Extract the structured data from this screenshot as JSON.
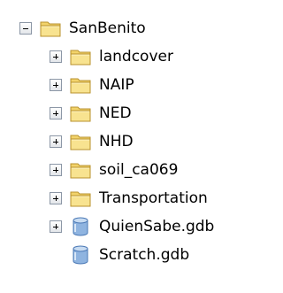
{
  "tree": {
    "root": {
      "label": "SanBenito",
      "expanded": true,
      "icon": "folder-icon"
    },
    "children": [
      {
        "label": "landcover",
        "icon": "folder-icon",
        "expandable": true
      },
      {
        "label": "NAIP",
        "icon": "folder-icon",
        "expandable": true
      },
      {
        "label": "NED",
        "icon": "folder-icon",
        "expandable": true
      },
      {
        "label": "NHD",
        "icon": "folder-icon",
        "expandable": true
      },
      {
        "label": "soil_ca069",
        "icon": "folder-icon",
        "expandable": true
      },
      {
        "label": "Transportation",
        "icon": "folder-icon",
        "expandable": true
      },
      {
        "label": "QuienSabe.gdb",
        "icon": "geodatabase-icon",
        "expandable": true
      },
      {
        "label": "Scratch.gdb",
        "icon": "geodatabase-icon",
        "expandable": false
      }
    ]
  },
  "colors": {
    "folder_fill": "#f7e08a",
    "folder_edge": "#c9a53a",
    "database_fill": "#8fb4e0",
    "database_edge": "#4a78b5",
    "expander_border": "#8c97a6"
  }
}
